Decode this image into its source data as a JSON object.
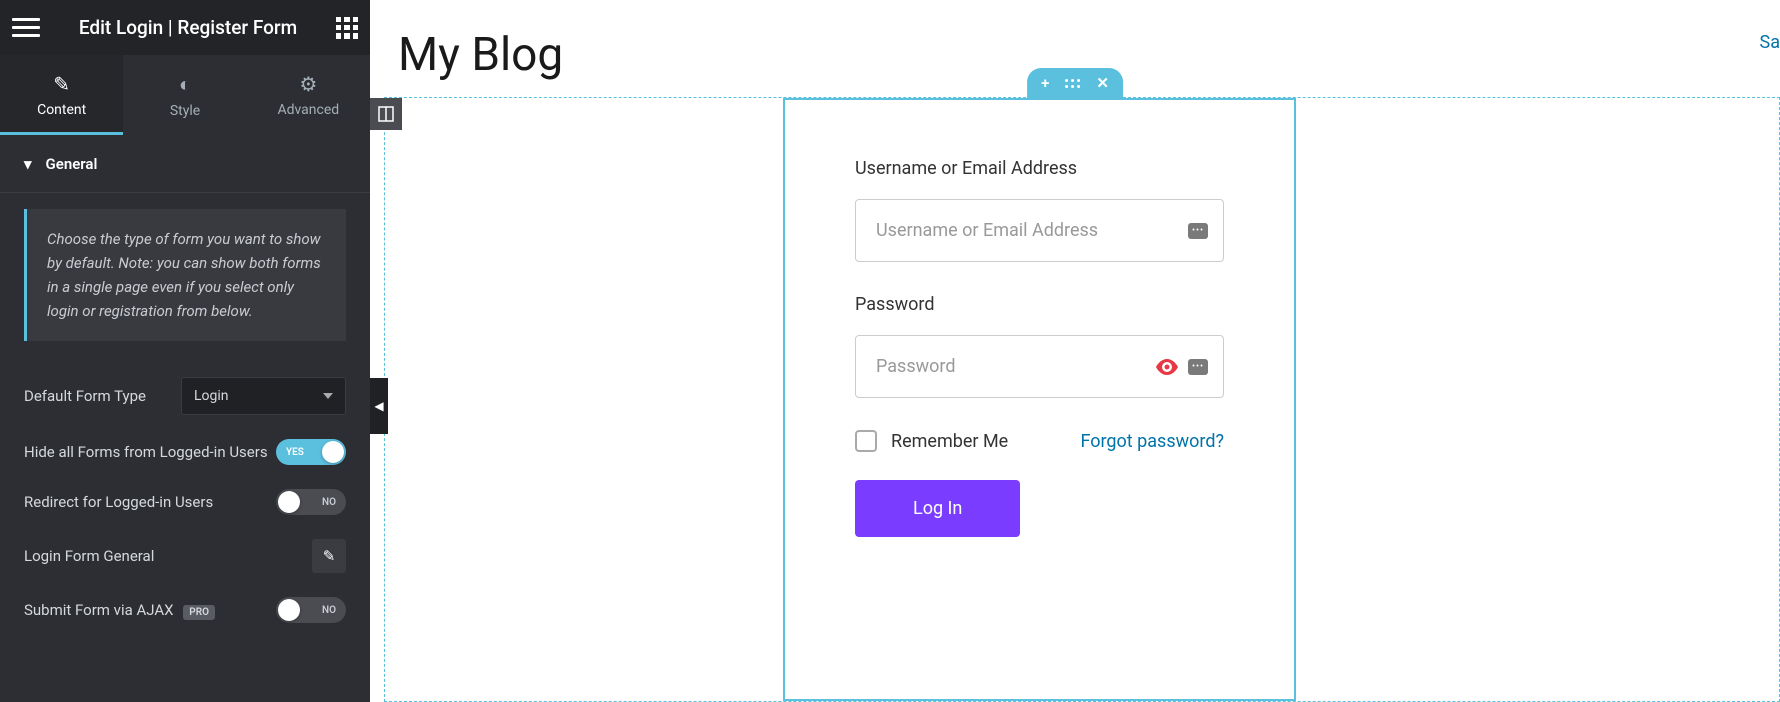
{
  "sidebar": {
    "title": "Edit Login | Register Form",
    "tabs": {
      "content": "Content",
      "style": "Style",
      "advanced": "Advanced"
    },
    "section_general": "General",
    "info_text": "Choose the type of form you want to show by default. Note: you can show both forms in a single page even if you select only login or registration from below.",
    "default_form_label": "Default Form Type",
    "default_form_value": "Login",
    "hide_forms_label": "Hide all Forms from Logged-in Users",
    "hide_forms_toggle": "YES",
    "redirect_label": "Redirect for Logged-in Users",
    "redirect_toggle": "NO",
    "login_form_general": "Login Form General",
    "submit_ajax_label": "Submit Form via AJAX",
    "submit_ajax_pro": "PRO",
    "submit_ajax_toggle": "NO"
  },
  "canvas": {
    "page_title": "My Blog",
    "sample_link": "Sa",
    "form": {
      "username_label": "Username or Email Address",
      "username_placeholder": "Username or Email Address",
      "password_label": "Password",
      "password_placeholder": "Password",
      "remember_label": "Remember Me",
      "forgot_link": "Forgot password?",
      "submit_label": "Log In"
    }
  }
}
